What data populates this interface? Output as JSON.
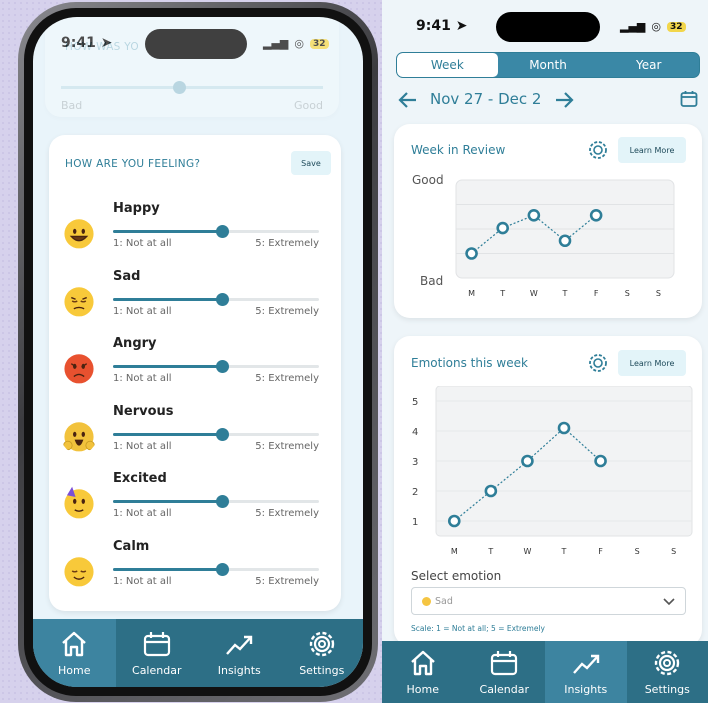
{
  "left_phone": {
    "status": {
      "time": "9:41",
      "battery": "32"
    },
    "previous_card": {
      "title": "HOW WAS YO",
      "scale_low": "Bad",
      "scale_high": "Good"
    },
    "feeling_card": {
      "title": "HOW ARE YOU FEELING?",
      "save_label": "Save"
    },
    "emotions": [
      {
        "name": "Happy",
        "icon": "grinning-face-icon",
        "value_fraction": 0.53,
        "scale_low": "1: Not at all",
        "scale_high": "5: Extremely"
      },
      {
        "name": "Sad",
        "icon": "pensive-face-icon",
        "value_fraction": 0.53,
        "scale_low": "1: Not at all",
        "scale_high": "5: Extremely"
      },
      {
        "name": "Angry",
        "icon": "angry-face-icon",
        "value_fraction": 0.53,
        "scale_low": "1: Not at all",
        "scale_high": "5: Extremely"
      },
      {
        "name": "Nervous",
        "icon": "screaming-face-icon",
        "value_fraction": 0.53,
        "scale_low": "1: Not at all",
        "scale_high": "5: Extremely"
      },
      {
        "name": "Excited",
        "icon": "partying-face-icon",
        "value_fraction": 0.53,
        "scale_low": "1: Not at all",
        "scale_high": "5: Extremely"
      },
      {
        "name": "Calm",
        "icon": "relieved-face-icon",
        "value_fraction": 0.53,
        "scale_low": "1: Not at all",
        "scale_high": "5: Extremely"
      }
    ],
    "tabbar": [
      {
        "label": "Home",
        "icon": "home-icon",
        "active": true
      },
      {
        "label": "Calendar",
        "icon": "calendar-icon",
        "active": false
      },
      {
        "label": "Insights",
        "icon": "insights-icon",
        "active": false
      },
      {
        "label": "Settings",
        "icon": "gear-icon",
        "active": false
      }
    ]
  },
  "right_phone": {
    "status": {
      "time": "9:41",
      "battery": "32"
    },
    "segments": [
      {
        "label": "Week",
        "active": true
      },
      {
        "label": "Month",
        "active": false
      },
      {
        "label": "Year",
        "active": false
      }
    ],
    "date_range": "Nov 27 - Dec 2",
    "review_card": {
      "title": "Week in Review",
      "learn_more": "Learn More",
      "y_top": "Good",
      "y_bottom": "Bad",
      "days": [
        "M",
        "T",
        "W",
        "T",
        "F",
        "S",
        "S"
      ],
      "values": [
        0.25,
        0.51,
        0.64,
        0.38,
        0.64,
        null,
        null
      ]
    },
    "emotions_card": {
      "title": "Emotions this week",
      "learn_more": "Learn More",
      "y_ticks": [
        "5",
        "4",
        "3",
        "2",
        "1"
      ],
      "days": [
        "M",
        "T",
        "W",
        "T",
        "F",
        "S",
        "S"
      ],
      "values": [
        1.0,
        2.0,
        3.0,
        4.1,
        3.0,
        null,
        null
      ],
      "select_label": "Select emotion",
      "select_value": "Sad",
      "select_icon": "pensive-face-icon",
      "scale_note": "Scale: 1 = Not at all; 5 = Extremely"
    },
    "tabbar": [
      {
        "label": "Home",
        "icon": "home-icon",
        "active": false
      },
      {
        "label": "Calendar",
        "icon": "calendar-icon",
        "active": false
      },
      {
        "label": "Insights",
        "icon": "insights-icon",
        "active": true
      },
      {
        "label": "Settings",
        "icon": "gear-icon",
        "active": false
      }
    ]
  },
  "colors": {
    "accent": "#2f7e98",
    "tabbar": "#2d6f86",
    "light_bg": "#e9f4fa"
  }
}
